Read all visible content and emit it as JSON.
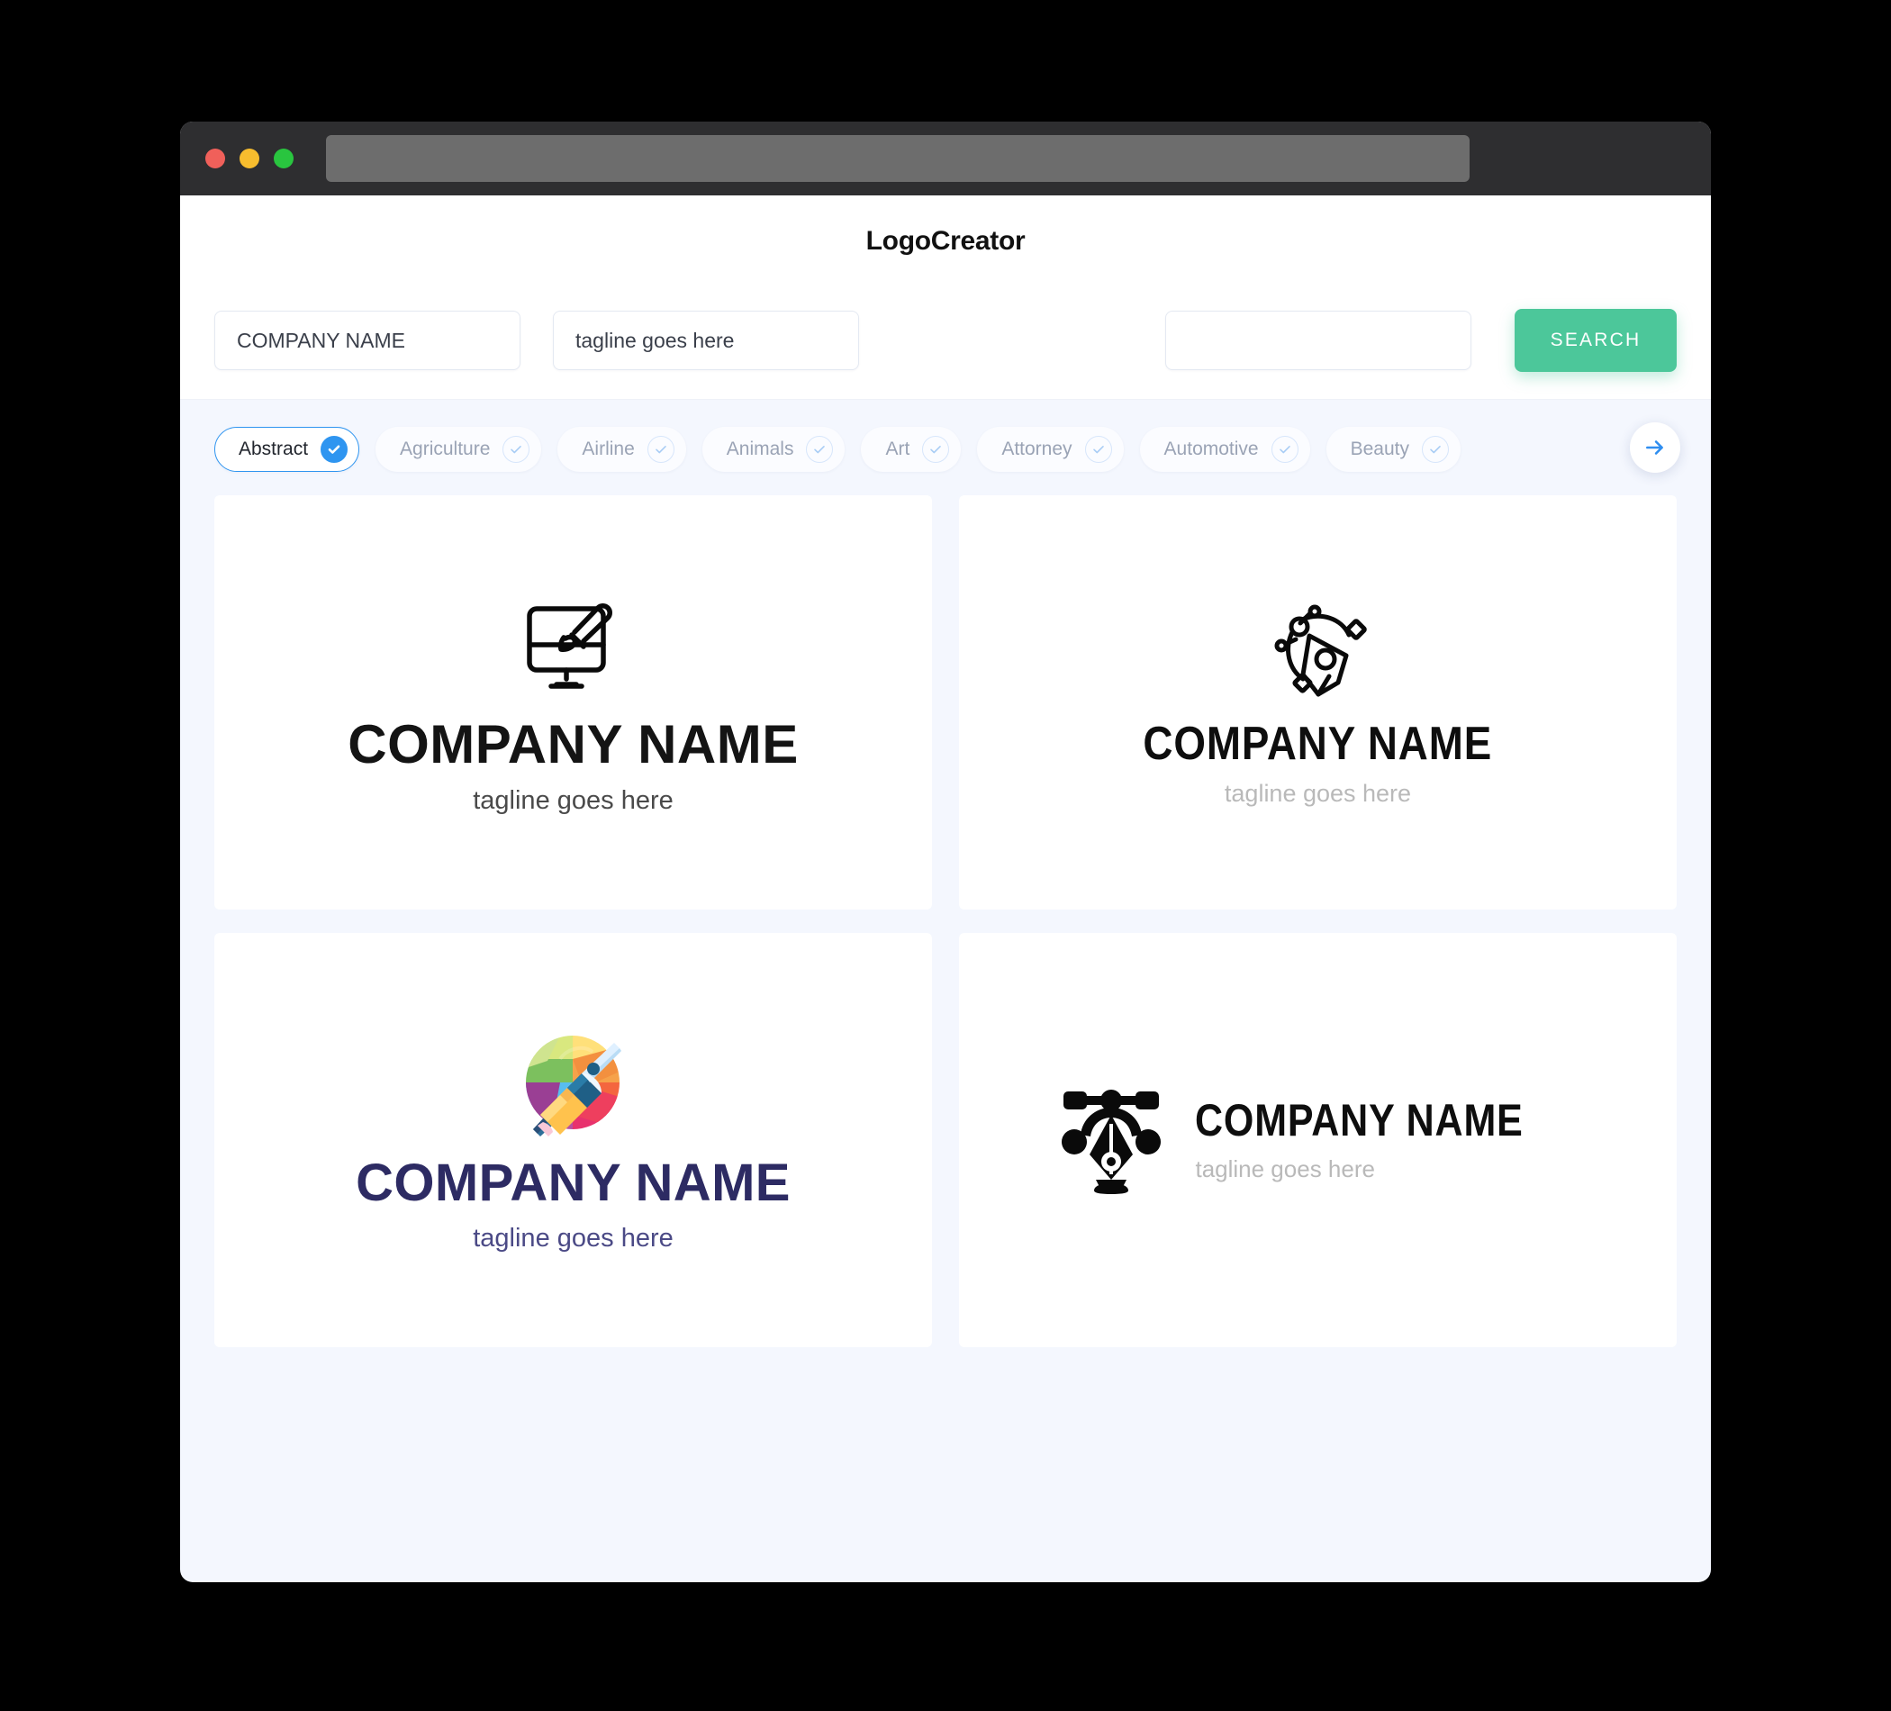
{
  "window": {
    "traffic_lights": [
      "close",
      "minimize",
      "maximize"
    ],
    "url_value": ""
  },
  "header": {
    "app_title": "LogoCreator"
  },
  "search": {
    "company_value": "COMPANY NAME",
    "company_placeholder": "COMPANY NAME",
    "tagline_value": "tagline goes here",
    "tagline_placeholder": "tagline goes here",
    "extra_value": "",
    "extra_placeholder": "",
    "search_label": "SEARCH",
    "search_color": "#4cc79a"
  },
  "categories": {
    "selected": "Abstract",
    "accent": "#2f95f0",
    "items": [
      {
        "label": "Abstract",
        "selected": true
      },
      {
        "label": "Agriculture",
        "selected": false
      },
      {
        "label": "Airline",
        "selected": false
      },
      {
        "label": "Animals",
        "selected": false
      },
      {
        "label": "Art",
        "selected": false
      },
      {
        "label": "Attorney",
        "selected": false
      },
      {
        "label": "Automotive",
        "selected": false
      },
      {
        "label": "Beauty",
        "selected": false
      }
    ],
    "next_icon": "arrow-right-icon"
  },
  "results": {
    "cards": [
      {
        "icon": "monitor-paintbrush-icon",
        "name": "COMPANY NAME",
        "tagline": "tagline goes here",
        "name_color": "#141414",
        "tagline_color": "#4a4a4a",
        "layout": "stacked"
      },
      {
        "icon": "pen-nib-bezier-outline-icon",
        "name": "COMPANY NAME",
        "tagline": "tagline goes here",
        "name_color": "#0e0e0e",
        "tagline_color": "#b9b9b9",
        "layout": "stacked"
      },
      {
        "icon": "color-wheel-pencil-icon",
        "name": "COMPANY NAME",
        "tagline": "tagline goes here",
        "name_color": "#2d2b63",
        "tagline_color": "#4b4a86",
        "layout": "stacked"
      },
      {
        "icon": "pen-nib-bezier-solid-icon",
        "name": "COMPANY NAME",
        "tagline": "tagline goes here",
        "name_color": "#0e0e0e",
        "tagline_color": "#b9b9b9",
        "layout": "horizontal"
      }
    ]
  }
}
